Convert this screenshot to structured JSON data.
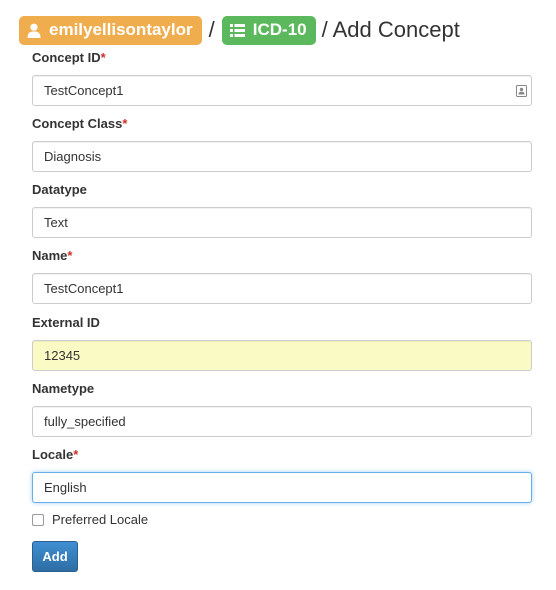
{
  "breadcrumb": {
    "user": "emilyellisontaylor",
    "user_icon": "person-icon",
    "source": "ICD-10",
    "source_icon": "list-icon",
    "separator": "/",
    "page_title": "/ Add Concept"
  },
  "colors": {
    "user_badge": "#f0ad4e",
    "source_badge": "#5cb85c",
    "required_marker": "#c9302c",
    "autofill_background": "#fafbc4",
    "focus_border": "#66afe9",
    "primary_button": "#337ab7"
  },
  "form": {
    "required_marker": "*",
    "concept_id": {
      "label": "Concept ID",
      "value": "TestConcept1",
      "icon": "contact-card-icon"
    },
    "concept_class": {
      "label": "Concept Class",
      "value": "Diagnosis"
    },
    "datatype": {
      "label": "Datatype",
      "value": "Text"
    },
    "name": {
      "label": "Name",
      "value": "TestConcept1"
    },
    "external_id": {
      "label": "External ID",
      "value": "12345"
    },
    "nametype": {
      "label": "Nametype",
      "value": "fully_specified"
    },
    "locale": {
      "label": "Locale",
      "value": "English"
    },
    "preferred_locale": {
      "label": "Preferred Locale",
      "checked": false
    },
    "submit_label": "Add"
  }
}
